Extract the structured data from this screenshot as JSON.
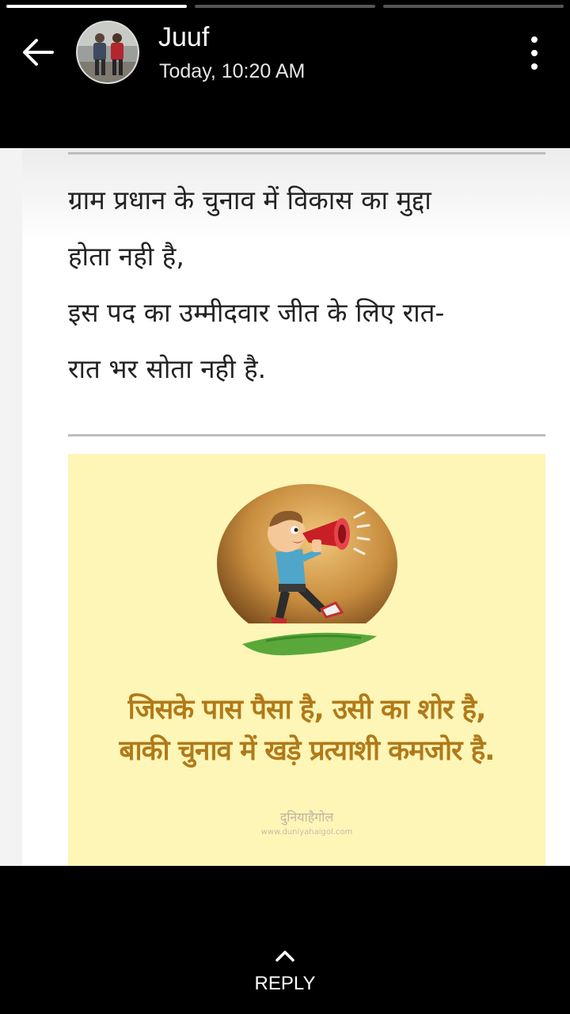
{
  "progress": [
    {
      "fraction": 1.0
    },
    {
      "fraction": 0.0
    },
    {
      "fraction": 0.0
    }
  ],
  "header": {
    "back_icon": "arrow-left-icon",
    "contact_name": "Juuf",
    "timestamp": "Today, 10:20 AM",
    "menu_icon": "more-vertical-icon"
  },
  "status": {
    "poem_lines": [
      "ग्राम प्रधान के चुनाव में विकास का मुद्दा",
      "होता नही है,",
      "इस पद का उम्मीदवार जीत के लिए रात-",
      "रात भर सोता नही है."
    ],
    "image": {
      "quote_lines": [
        "जिसके पास पैसा है, उसी का शोर है,",
        "बाकी चुनाव में खड़े प्रत्याशी कमजोर है."
      ],
      "watermark_title": "दुनियाहैगोल",
      "watermark_url": "www.duniyahaigol.com",
      "quote_color": "#b07a1a",
      "background_color": "#fdf6b7"
    }
  },
  "footer": {
    "reply_icon": "chevron-up-icon",
    "reply_label": "REPLY"
  }
}
